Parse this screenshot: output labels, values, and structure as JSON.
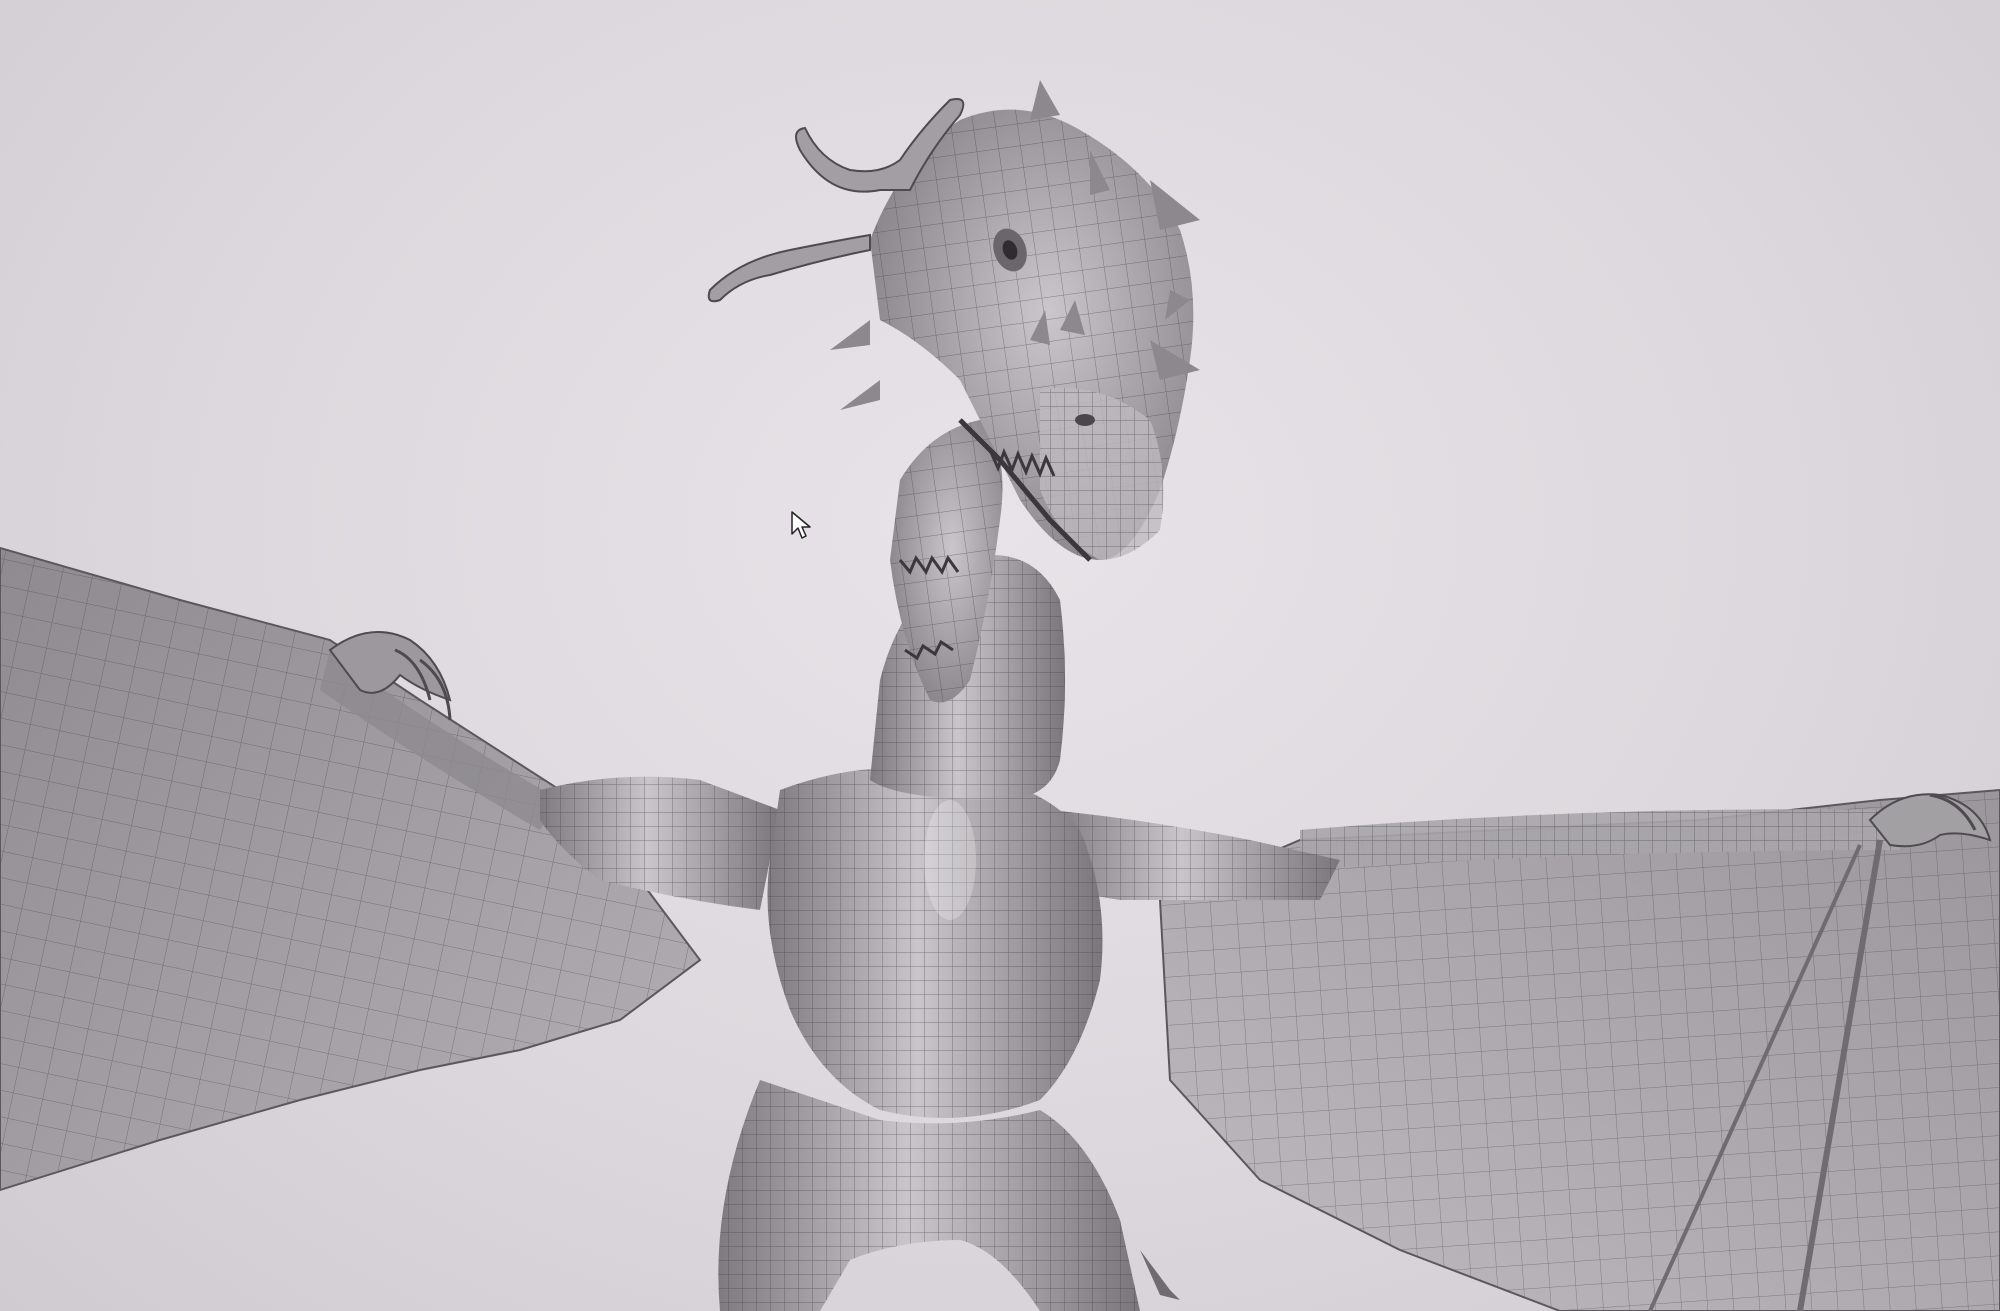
{
  "scene": {
    "subject": "dragon-wireframe-model",
    "colors": {
      "background": "#dcd8dd",
      "model_fill": "#9e9a9f",
      "model_highlight": "#cfcbd0",
      "model_shadow": "#6b676c",
      "wireframe": "#3c393d"
    }
  },
  "cursor": {
    "icon": "arrow-cursor-icon"
  }
}
